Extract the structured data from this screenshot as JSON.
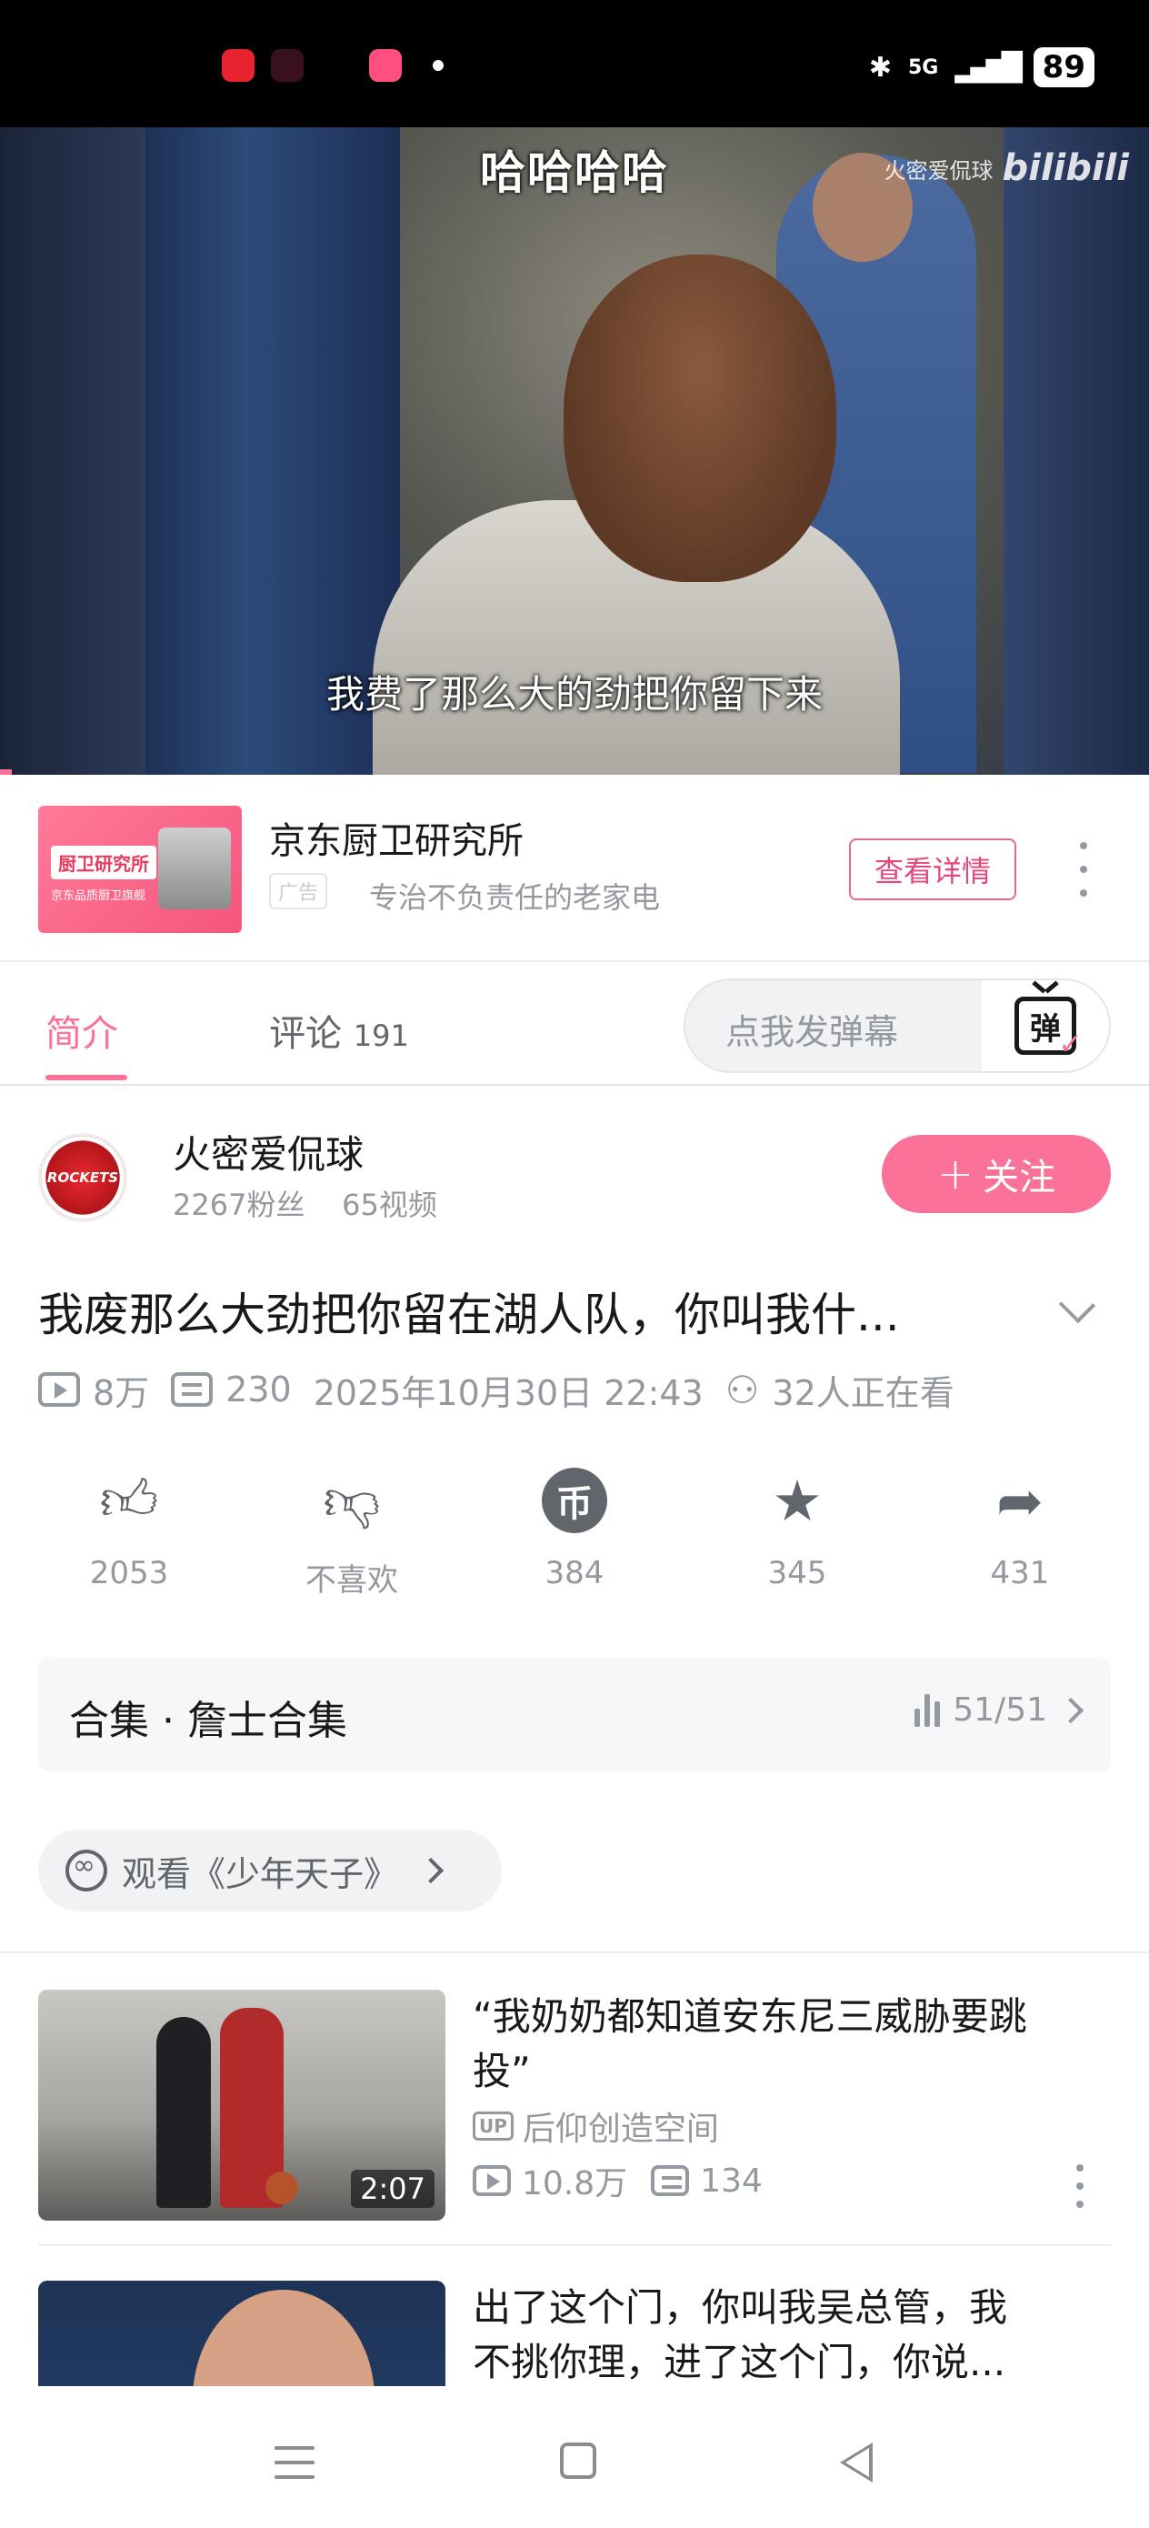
{
  "status_bar": {
    "network": "5G",
    "battery": "89",
    "notif_colors": [
      "#e8232f",
      "#c2185b",
      "#ff4f7e"
    ]
  },
  "video": {
    "top_caption": "哈哈哈哈",
    "watermark_channel": "火密爱侃球",
    "watermark_logo": "bilibili",
    "subtitle": "我费了那么大的劲把你留下来",
    "progress_fraction": 0.01
  },
  "ad": {
    "thumb_text": "厨卫研究所",
    "thumb_sub": "京东品质厨卫旗舰",
    "title": "京东厨卫研究所",
    "tag": "广告",
    "description": "专治不负责任的老家电",
    "button": "查看详情"
  },
  "tabs": {
    "intro": "简介",
    "comments": "评论",
    "comments_count": "191",
    "danmaku_placeholder": "点我发弹幕",
    "danmaku_button": "弹"
  },
  "uploader": {
    "name": "火密爱侃球",
    "stats": "2267粉丝    65视频",
    "avatar_text": "ROCKETS",
    "follow_label": "关注",
    "follow_plus": "+"
  },
  "video_info": {
    "title": "我废那么大劲把你留在湖人队，你叫我什...",
    "views": "8万",
    "danmaku_count": "230",
    "date": "2025年10月30日 22:43",
    "watching": "32人正在看"
  },
  "actions": [
    {
      "name": "like",
      "icon": "thumbs-up-icon",
      "label": "2053"
    },
    {
      "name": "dislike",
      "icon": "thumbs-down-icon",
      "label": "不喜欢"
    },
    {
      "name": "coin",
      "icon": "coin-icon",
      "label": "384"
    },
    {
      "name": "favorite",
      "icon": "star-icon",
      "label": "345"
    },
    {
      "name": "share",
      "icon": "share-icon",
      "label": "431"
    }
  ],
  "collection": {
    "title": "合集 · 詹士合集",
    "progress": "51/51"
  },
  "related_show": {
    "label": "观看《少年天子》"
  },
  "recommendations": [
    {
      "title_line1": "“我奶奶都知道安东尼三威胁要跳",
      "title_line2": "投”",
      "up_badge": "UP",
      "uploader": "后仰创造空间",
      "views": "10.8万",
      "danmaku": "134",
      "duration": "2:07"
    },
    {
      "title_line1": "出了这个门，你叫我吴总管，我",
      "title_line2": "不挑你理，进了这个门，你说..."
    }
  ],
  "colors": {
    "accent": "#fb7299",
    "text_primary": "#18191c",
    "text_secondary": "#9499a0"
  }
}
